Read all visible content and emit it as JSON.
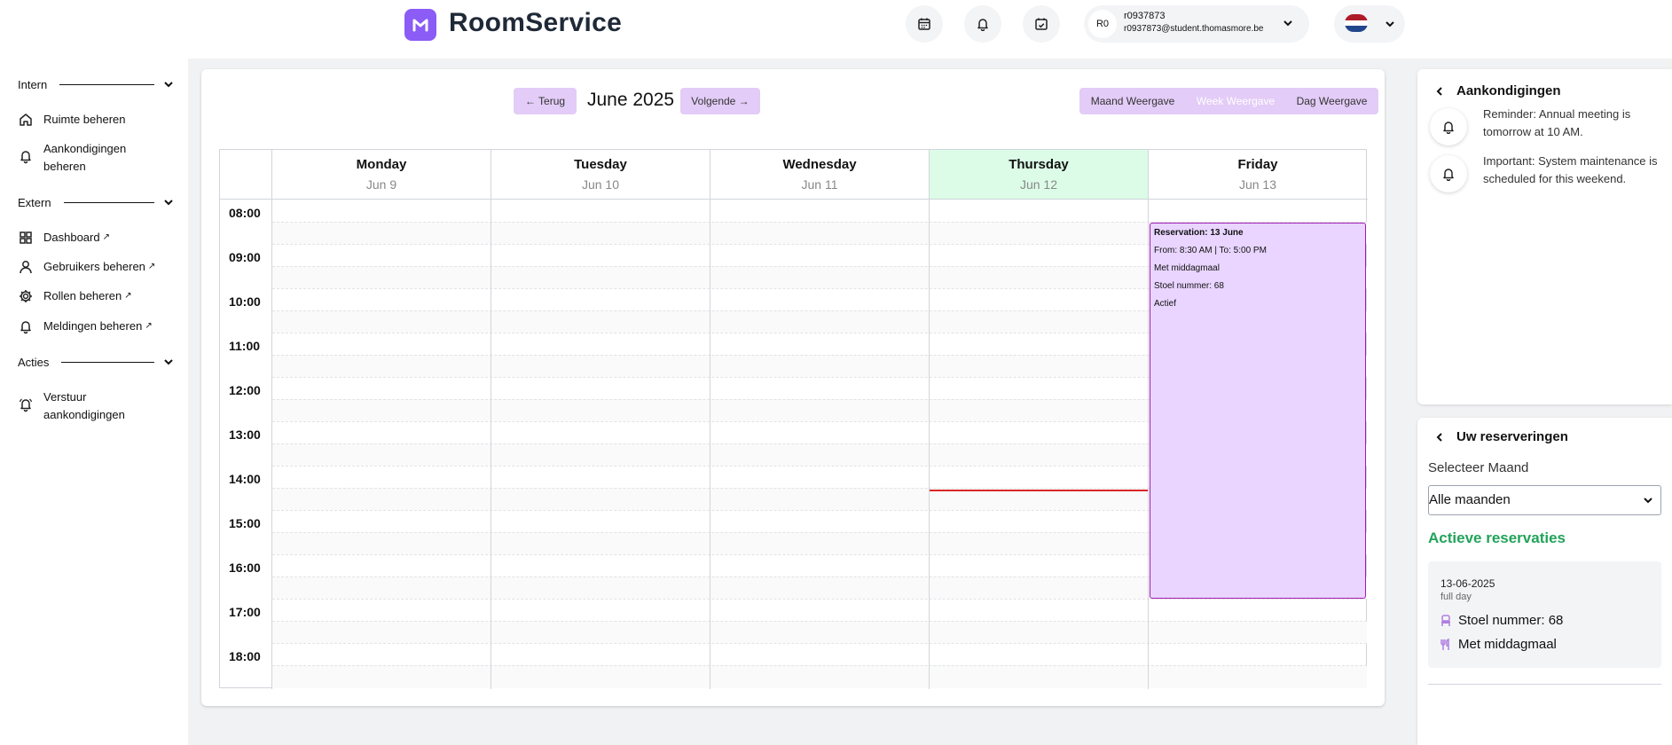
{
  "app": {
    "name": "RoomService",
    "logo_letter": "M"
  },
  "user": {
    "initials": "R0",
    "id": "r0937873",
    "email": "r0937873@student.thomasmore.be"
  },
  "sidebar": {
    "sections": [
      {
        "label": "Intern",
        "items": [
          {
            "label": "Ruimte beheren"
          },
          {
            "label": "Aankondigingen beheren"
          }
        ]
      },
      {
        "label": "Extern",
        "items": [
          {
            "label": "Dashboard"
          },
          {
            "label": "Gebruikers beheren"
          },
          {
            "label": "Rollen beheren"
          },
          {
            "label": "Meldingen beheren"
          }
        ]
      },
      {
        "label": "Acties",
        "items": [
          {
            "label": "Verstuur aankondigingen"
          }
        ]
      }
    ]
  },
  "calendar": {
    "prev_label": "← Terug",
    "next_label": "Volgende →",
    "title": "June 2025",
    "views": [
      "Maand Weergave",
      "Week Weergave",
      "Dag Weergave"
    ],
    "active_view": "Week Weergave",
    "days": [
      {
        "name": "Monday",
        "date": "Jun 9"
      },
      {
        "name": "Tuesday",
        "date": "Jun 10"
      },
      {
        "name": "Wednesday",
        "date": "Jun 11"
      },
      {
        "name": "Thursday",
        "date": "Jun 12"
      },
      {
        "name": "Friday",
        "date": "Jun 13"
      }
    ],
    "today_index": 3,
    "times": [
      "08:00",
      "09:00",
      "10:00",
      "11:00",
      "12:00",
      "13:00",
      "14:00",
      "15:00",
      "16:00",
      "17:00",
      "18:00"
    ],
    "event": {
      "title": "Reservation: 13 June",
      "time": "From: 8:30 AM | To: 5:00 PM",
      "meal": "Met middagmaal",
      "seat": "Stoel nummer: 68",
      "status": "Actief"
    },
    "colors": {
      "today_bg": "#dcfce7",
      "event_bg": "#e9d5ff",
      "event_border": "#a21caf",
      "button_bg": "#e3ccf7",
      "now_line": "#dc2626"
    }
  },
  "announcements": {
    "title": "Aankondigingen",
    "items": [
      {
        "text": "Reminder: Annual meeting is tomorrow at 10 AM."
      },
      {
        "text": "Important: System maintenance is scheduled for this weekend."
      }
    ]
  },
  "reservations": {
    "title": "Uw reserveringen",
    "select_label": "Selecteer Maand",
    "select_value": "Alle maanden",
    "active_title": "Actieve reservaties",
    "item": {
      "date": "13-06-2025",
      "duration": "full day",
      "seat": "Stoel nummer: 68",
      "meal": "Met middagmaal"
    }
  }
}
